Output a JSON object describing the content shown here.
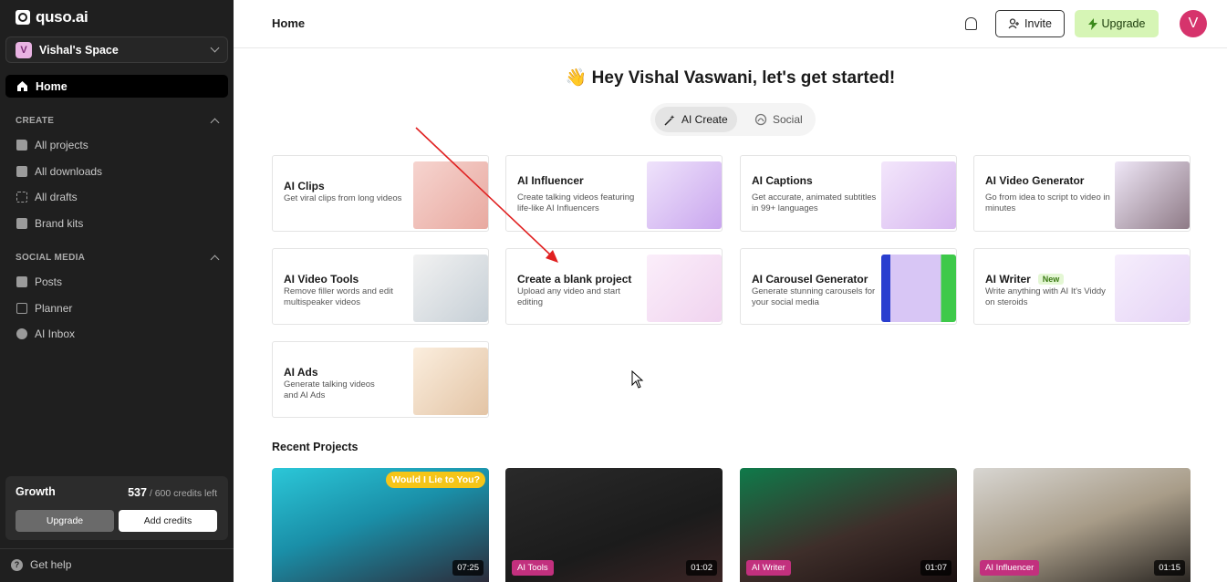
{
  "brand": {
    "name": "quso.ai"
  },
  "workspace": {
    "initial": "V",
    "name": "Vishal's Space"
  },
  "nav": {
    "home": "Home",
    "create_heading": "CREATE",
    "create_items": [
      "All projects",
      "All downloads",
      "All drafts",
      "Brand kits"
    ],
    "social_heading": "SOCIAL MEDIA",
    "social_items": [
      "Posts",
      "Planner",
      "AI Inbox"
    ]
  },
  "credits": {
    "plan": "Growth",
    "used": "537",
    "total": "/ 600 credits left",
    "upgrade": "Upgrade",
    "add": "Add credits"
  },
  "help": {
    "label": "Get help"
  },
  "header": {
    "title": "Home",
    "invite": "Invite",
    "upgrade": "Upgrade",
    "avatar_initial": "V"
  },
  "greeting": "👋 Hey Vishal Vaswani, let's get started!",
  "toggle": {
    "active": "AI Create",
    "inactive": "Social"
  },
  "tools": [
    {
      "title": "AI Clips",
      "desc": "Get viral clips from long videos"
    },
    {
      "title": "AI Influencer",
      "desc": "Create talking videos featuring life-like AI Influencers"
    },
    {
      "title": "AI Captions",
      "desc": "Get accurate, animated subtitles in 99+ languages"
    },
    {
      "title": "AI Video Generator",
      "desc": "Go from idea to script to video in minutes"
    },
    {
      "title": "AI Video Tools",
      "desc": "Remove filler words and edit multispeaker videos"
    },
    {
      "title": "Create a blank project",
      "desc": "Upload any video and start editing"
    },
    {
      "title": "AI Carousel Generator",
      "desc": "Generate stunning carousels for your social media"
    },
    {
      "title": "AI Writer",
      "badge": "New",
      "desc": "Write anything with AI It's Viddy on steroids"
    },
    {
      "title": "AI Ads",
      "desc": "Generate talking videos and AI Ads"
    }
  ],
  "recent": {
    "title": "Recent Projects",
    "items": [
      {
        "duration": "07:25",
        "label": "Would I Lie to You?"
      },
      {
        "tag": "AI Tools",
        "duration": "01:02"
      },
      {
        "tag": "AI Writer",
        "duration": "01:07"
      },
      {
        "tag": "AI Influencer",
        "duration": "01:15"
      }
    ]
  }
}
